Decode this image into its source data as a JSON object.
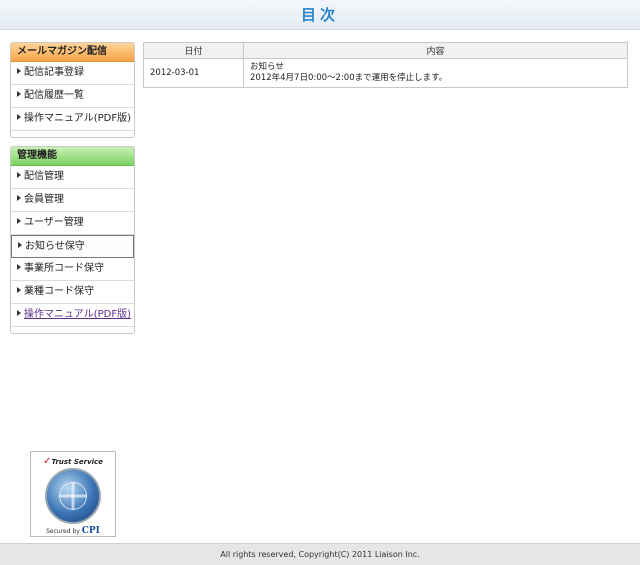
{
  "header": {
    "title": "目次"
  },
  "sidebar": {
    "mail_section": {
      "heading": "メールマガジン配信",
      "items": [
        {
          "label": "配信記事登録"
        },
        {
          "label": "配信履歴一覧"
        },
        {
          "label": "操作マニュアル(PDF版)"
        }
      ]
    },
    "admin_section": {
      "heading": "管理機能",
      "items": [
        {
          "label": "配信管理"
        },
        {
          "label": "会員管理"
        },
        {
          "label": "ユーザー管理"
        },
        {
          "label": "お知らせ保守"
        },
        {
          "label": "事業所コード保守"
        },
        {
          "label": "業種コード保守"
        },
        {
          "label": "操作マニュアル(PDF版)"
        }
      ]
    }
  },
  "badge": {
    "title": "Trust Service",
    "secured_by": "Secured by",
    "brand": "CPI"
  },
  "news": {
    "headers": {
      "date": "日付",
      "content": "内容"
    },
    "rows": [
      {
        "date": "2012-03-01",
        "title": "お知らせ",
        "body": "2012年4月7日0:00～2:00まで運用を停止します。"
      }
    ]
  },
  "footer": {
    "text": "All rights reserved, Copyright(C) 2011   Liaison Inc."
  },
  "colors": {
    "title": "#2a86c8",
    "mail_heading": "#f7a546",
    "admin_heading": "#7cd263"
  }
}
